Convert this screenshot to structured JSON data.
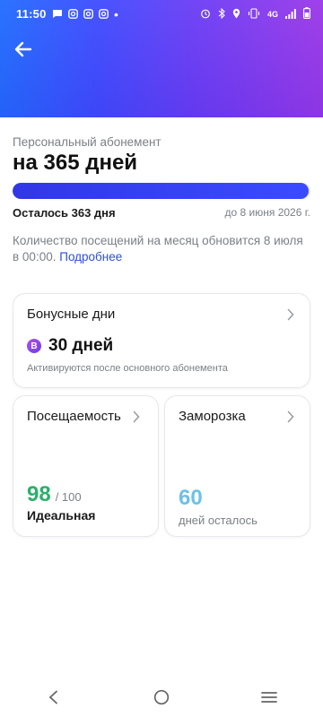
{
  "status_bar": {
    "time": "11:50",
    "network": "4G",
    "dot": "•"
  },
  "header": {
    "back_icon": "arrow-left-icon",
    "gradient_colors": [
      "#1f6cff",
      "#6a3cf5",
      "#9b37e8"
    ]
  },
  "subscription": {
    "type_label": "Персональный абонемент",
    "title": "на 365 дней",
    "progress_fraction": 0.995,
    "remaining_label": "Осталось 363 дня",
    "until_label": "до 8 июня 2026 г.",
    "visits_note": "Количество посещений на месяц обновится 8 июля в 00:00.",
    "more_link": "Подробнее"
  },
  "bonus_card": {
    "title": "Бонусные дни",
    "badge_letter": "B",
    "value": "30 дней",
    "note": "Активируются после основного абонемента"
  },
  "attendance_card": {
    "title": "Посещаемость",
    "score": "98",
    "score_max": "/ 100",
    "rating": "Идеальная",
    "score_color": "#2bb06c"
  },
  "freeze_card": {
    "title": "Заморозка",
    "value": "60",
    "label": "дней осталось",
    "value_color": "#6cc1e8"
  },
  "nav": {
    "back": "nav-back-icon",
    "home": "nav-home-icon",
    "menu": "nav-recents-icon"
  }
}
